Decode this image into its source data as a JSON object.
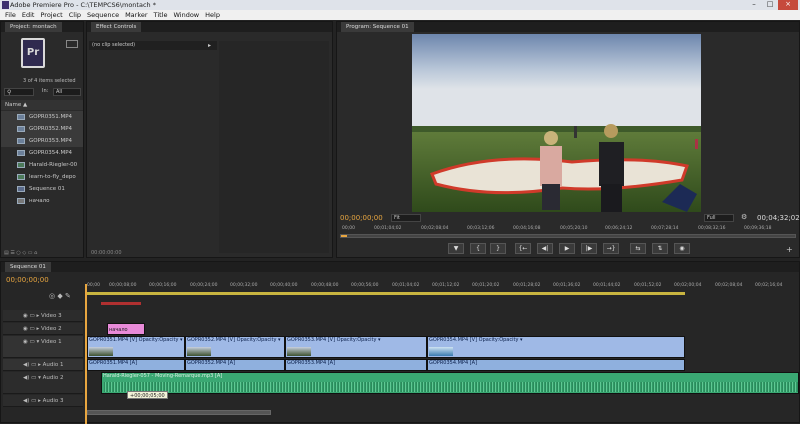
{
  "window": {
    "title": "Adobe Premiere Pro - C:\\TEMPCS6\\montach *"
  },
  "menu": [
    "File",
    "Edit",
    "Project",
    "Clip",
    "Sequence",
    "Marker",
    "Title",
    "Window",
    "Help"
  ],
  "project": {
    "tab": "Project: montach",
    "app_icon_text": "Pr",
    "selection_info": "3 of 4 items selected",
    "in_label": "In:",
    "in_value": "All",
    "name_header": "Name",
    "items": [
      "GOPR0351.MP4",
      "GOPR0352.MP4",
      "GOPR0353.MP4",
      "GOPR0354.MP4",
      "Harald-Riegler-00",
      "learn-to-fly_depo",
      "Sequence 01",
      "начало"
    ]
  },
  "effect_controls": {
    "tab": "Effect Controls",
    "no_clip": "(no clip selected)",
    "timecode": "00:00:00:00"
  },
  "program": {
    "tab": "Program: Sequence 01",
    "timecode_left": "00;00;00;00",
    "fit": "Fit",
    "quality": "Full",
    "timecode_right": "00;04;32;02",
    "ruler": [
      "00;00",
      "00;01;04;02",
      "00;02;08;04",
      "00;03;12;06",
      "00;04;16;08",
      "00;05;20;10",
      "00;06;24;12",
      "00;07;28;14",
      "00;08;32;16",
      "00;09;36;18"
    ],
    "controls": [
      "▼",
      "{",
      "}",
      "{←",
      "◀|",
      "▶",
      "|▶",
      "→}",
      "⇆",
      "⇅",
      "◉"
    ]
  },
  "sequence": {
    "tab": "Sequence 01",
    "timecode": "00;00;00;00",
    "ruler": [
      "00;00",
      "00;00;08;00",
      "00;00;16;00",
      "00;00;24;00",
      "00;00;32;00",
      "00;00;40;00",
      "00;00;48;00",
      "00;00;56;00",
      "00;01;04;02",
      "00;01;12;02",
      "00;01;20;02",
      "00;01;28;02",
      "00;01;36;02",
      "00;01;44;02",
      "00;01;52;02",
      "00;02;00;04",
      "00;02;08;04",
      "00;02;16;04"
    ],
    "tracks": [
      {
        "id": "video3",
        "name": "Video 3"
      },
      {
        "id": "video2",
        "name": "Video 2"
      },
      {
        "id": "video1",
        "name": "Video 1"
      },
      {
        "id": "audio1",
        "name": "Audio 1"
      },
      {
        "id": "audio2",
        "name": "Audio 2"
      },
      {
        "id": "audio3",
        "name": "Audio 3"
      }
    ],
    "title_clip": "начало",
    "video_clips": [
      {
        "name": "GOPR0351.MP4 [V]",
        "fx": "Opacity:Opacity ▾"
      },
      {
        "name": "GOPR0352.MP4 [V]",
        "fx": "Opacity:Opacity ▾"
      },
      {
        "name": "GOPR0353.MP4 [V]",
        "fx": "Opacity:Opacity ▾"
      },
      {
        "name": "GOPR0354.MP4 [V]",
        "fx": "Opacity:Opacity ▾"
      }
    ],
    "audio_clips": [
      "GOPR0351.MP4 [A]",
      "GOPR0352.MP4 [A]",
      "GOPR0353.MP4 [A]",
      "GOPR0354.MP4 [A]"
    ],
    "music_clip": "Harald-Riegler-057 - Moving-Remarque.mp3 [A]",
    "tooltip": "+00;00;05;00"
  },
  "colors": {
    "accent": "#e8a640",
    "video_clip": "#9fb9e6",
    "audio_clip": "#8fb0de",
    "music_clip": "#3aa873",
    "title_clip": "#e88ad8"
  }
}
